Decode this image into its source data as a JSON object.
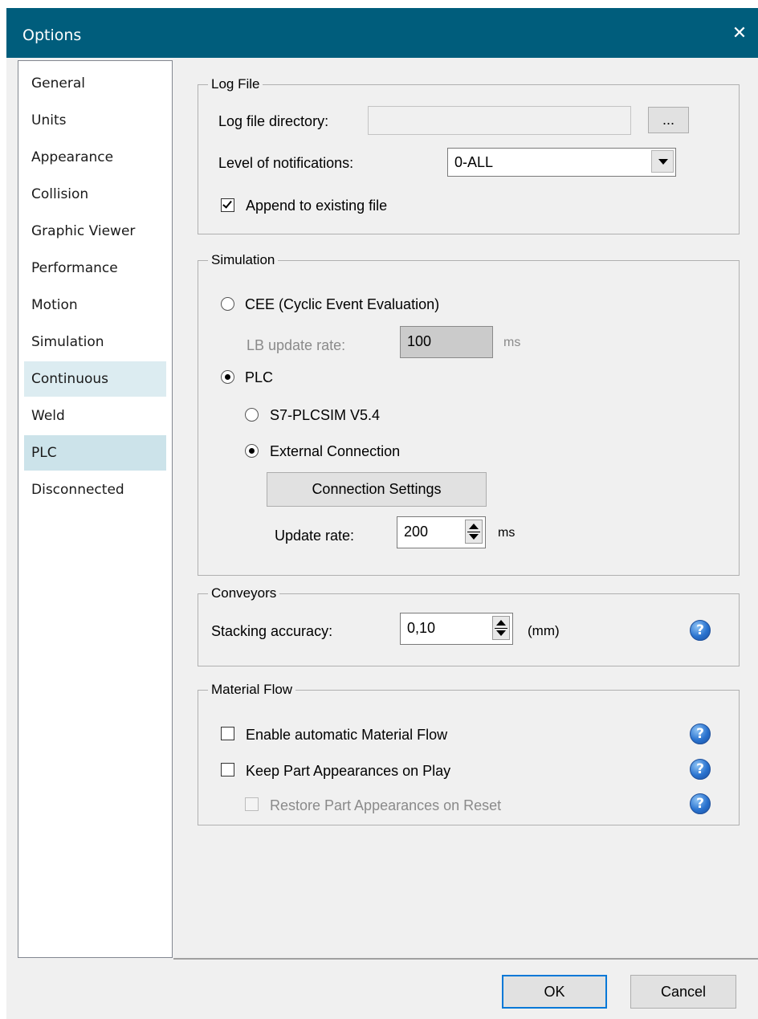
{
  "window": {
    "title": "Options",
    "close_glyph": "✕"
  },
  "nav": {
    "items": [
      {
        "label": "General"
      },
      {
        "label": "Units"
      },
      {
        "label": "Appearance"
      },
      {
        "label": "Collision"
      },
      {
        "label": "Graphic Viewer"
      },
      {
        "label": "Performance"
      },
      {
        "label": "Motion"
      },
      {
        "label": "Simulation"
      },
      {
        "label": "Continuous",
        "state": "hover"
      },
      {
        "label": "Weld"
      },
      {
        "label": "PLC",
        "state": "selected"
      },
      {
        "label": "Disconnected"
      }
    ]
  },
  "log_file": {
    "legend": "Log File",
    "directory_label": "Log file directory:",
    "directory_value": "",
    "browse_label": "...",
    "notification_label": "Level of notifications:",
    "notification_value": "0-ALL",
    "append_label": "Append to existing file",
    "append_checked": true
  },
  "simulation": {
    "legend": "Simulation",
    "cee_label": "CEE (Cyclic Event Evaluation)",
    "cee_selected": false,
    "lb_rate_label": "LB update rate:",
    "lb_rate_value": "100",
    "lb_rate_unit": "ms",
    "plc_label": "PLC",
    "plc_selected": true,
    "plcsim_label": "S7-PLCSIM V5.4",
    "plcsim_selected": false,
    "external_label": "External Connection",
    "external_selected": true,
    "connection_settings_label": "Connection Settings",
    "update_rate_label": "Update rate:",
    "update_rate_value": "200",
    "update_rate_unit": "ms"
  },
  "conveyors": {
    "legend": "Conveyors",
    "stacking_label": "Stacking accuracy:",
    "stacking_value": "0,10",
    "stacking_unit": "(mm)"
  },
  "material_flow": {
    "legend": "Material Flow",
    "enable_label": "Enable automatic Material Flow",
    "enable_checked": false,
    "keep_label": "Keep Part Appearances on Play",
    "keep_checked": false,
    "restore_label": "Restore Part Appearances on Reset",
    "restore_checked": false
  },
  "footer": {
    "ok_label": "OK",
    "cancel_label": "Cancel"
  },
  "icons": {
    "help": "?"
  },
  "colors": {
    "titlebar": "#005d7c",
    "nav_selected": "#cce3ea",
    "nav_hover": "#dcecf1",
    "help_blue": "#2a73cf"
  }
}
